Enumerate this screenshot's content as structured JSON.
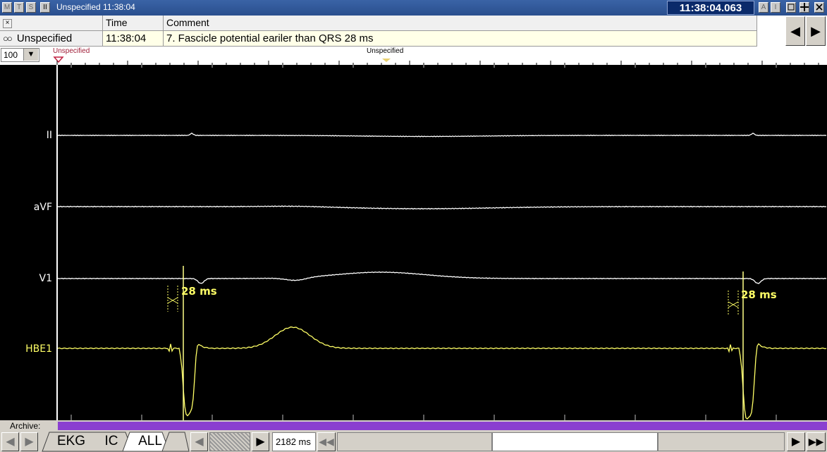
{
  "titlebar": {
    "buttons": [
      "M",
      "T",
      "S",
      "II"
    ],
    "title": "Unspecified  11:38:04",
    "clock": "11:38:04.063",
    "right_buttons": [
      "A",
      "I"
    ]
  },
  "event_table": {
    "close_glyph": "×",
    "headers": {
      "time": "Time",
      "comment": "Comment"
    },
    "row": {
      "label": "Unspecified",
      "time": "11:38:04",
      "comment": "7. Fascicle potential eariler than QRS 28 ms"
    }
  },
  "markers": {
    "zoom_value": "100",
    "left_marker": "Unspecified",
    "mid_marker": "Unspecified"
  },
  "channels": [
    {
      "label": "II",
      "color": "#ffffff"
    },
    {
      "label": "aVF",
      "color": "#ffffff"
    },
    {
      "label": "V1",
      "color": "#ffffff"
    },
    {
      "label": "HBE1",
      "color": "#ffff66"
    }
  ],
  "measurements": [
    {
      "text": "28 ms"
    },
    {
      "text": "28 ms"
    }
  ],
  "bottom": {
    "archive_label": "Archive:",
    "tabs": [
      "EKG",
      "IC",
      "ALL"
    ],
    "active_tab": "IC",
    "sweep": "2182 ms"
  },
  "colors": {
    "trace_white": "#ffffff",
    "trace_yellow": "#ffff66",
    "archive": "#8a3fd0",
    "titlebar": "#2a4f8e"
  }
}
